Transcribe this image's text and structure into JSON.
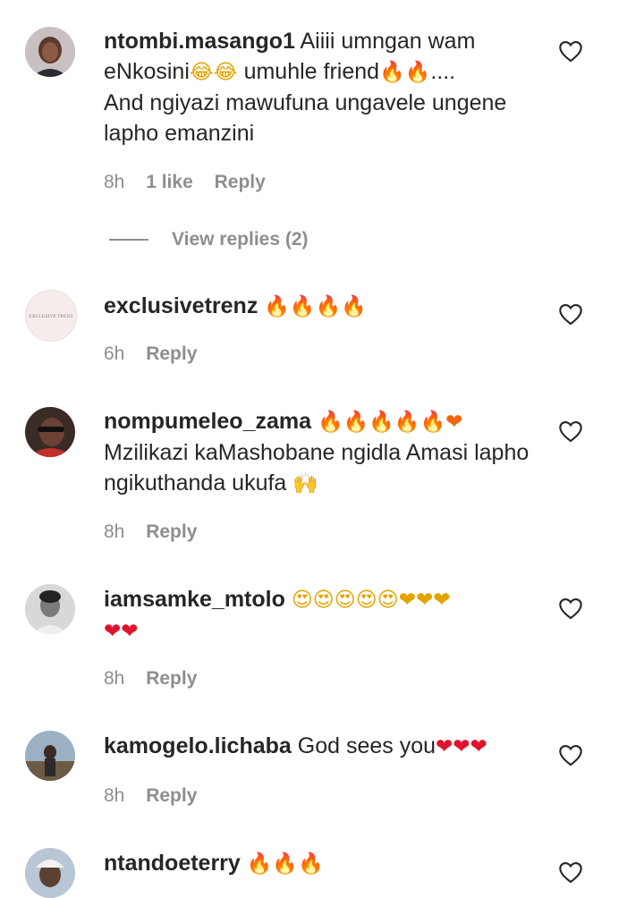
{
  "comments": [
    {
      "username": "ntombi.masango1",
      "text_parts": [
        "Aiiii umngan wam eNkosini",
        "😂😂",
        " umuhle friend",
        "🔥🔥",
        "....",
        "And ngiyazi mawufuna ungavele ungene lapho emanzini"
      ],
      "time": "8h",
      "likes": "1 like",
      "reply": "Reply",
      "view_replies": "View replies (2)"
    },
    {
      "username": "exclusivetrenz",
      "emoji": "🔥🔥🔥🔥",
      "time": "6h",
      "reply": "Reply",
      "avatar_text": "EXCLUSIVE TRENZ"
    },
    {
      "username": "nompumeleo_zama",
      "emoji": "🔥🔥🔥🔥🔥❤",
      "text": "Mzilikazi kaMashobane ngidla Amasi lapho ngikuthanda ukufa",
      "emoji2": "🙌",
      "time": "8h",
      "reply": "Reply"
    },
    {
      "username": "iamsamke_mtolo",
      "emoji": "😍😍😍😍😍❤❤❤",
      "emoji_line2": "❤❤",
      "time": "8h",
      "reply": "Reply"
    },
    {
      "username": "kamogelo.lichaba",
      "text": "God sees you",
      "emoji": "❤❤❤",
      "time": "8h",
      "reply": "Reply"
    },
    {
      "username": "ntandoeterry",
      "emoji": "🔥🔥🔥"
    }
  ],
  "icons": {
    "like": "heart-outline-icon",
    "fire": "fire-emoji",
    "heart": "red-heart-emoji"
  },
  "colors": {
    "text": "#262626",
    "meta": "#8e8e8e",
    "fire": "#f2640b",
    "heart": "#e0132b"
  }
}
